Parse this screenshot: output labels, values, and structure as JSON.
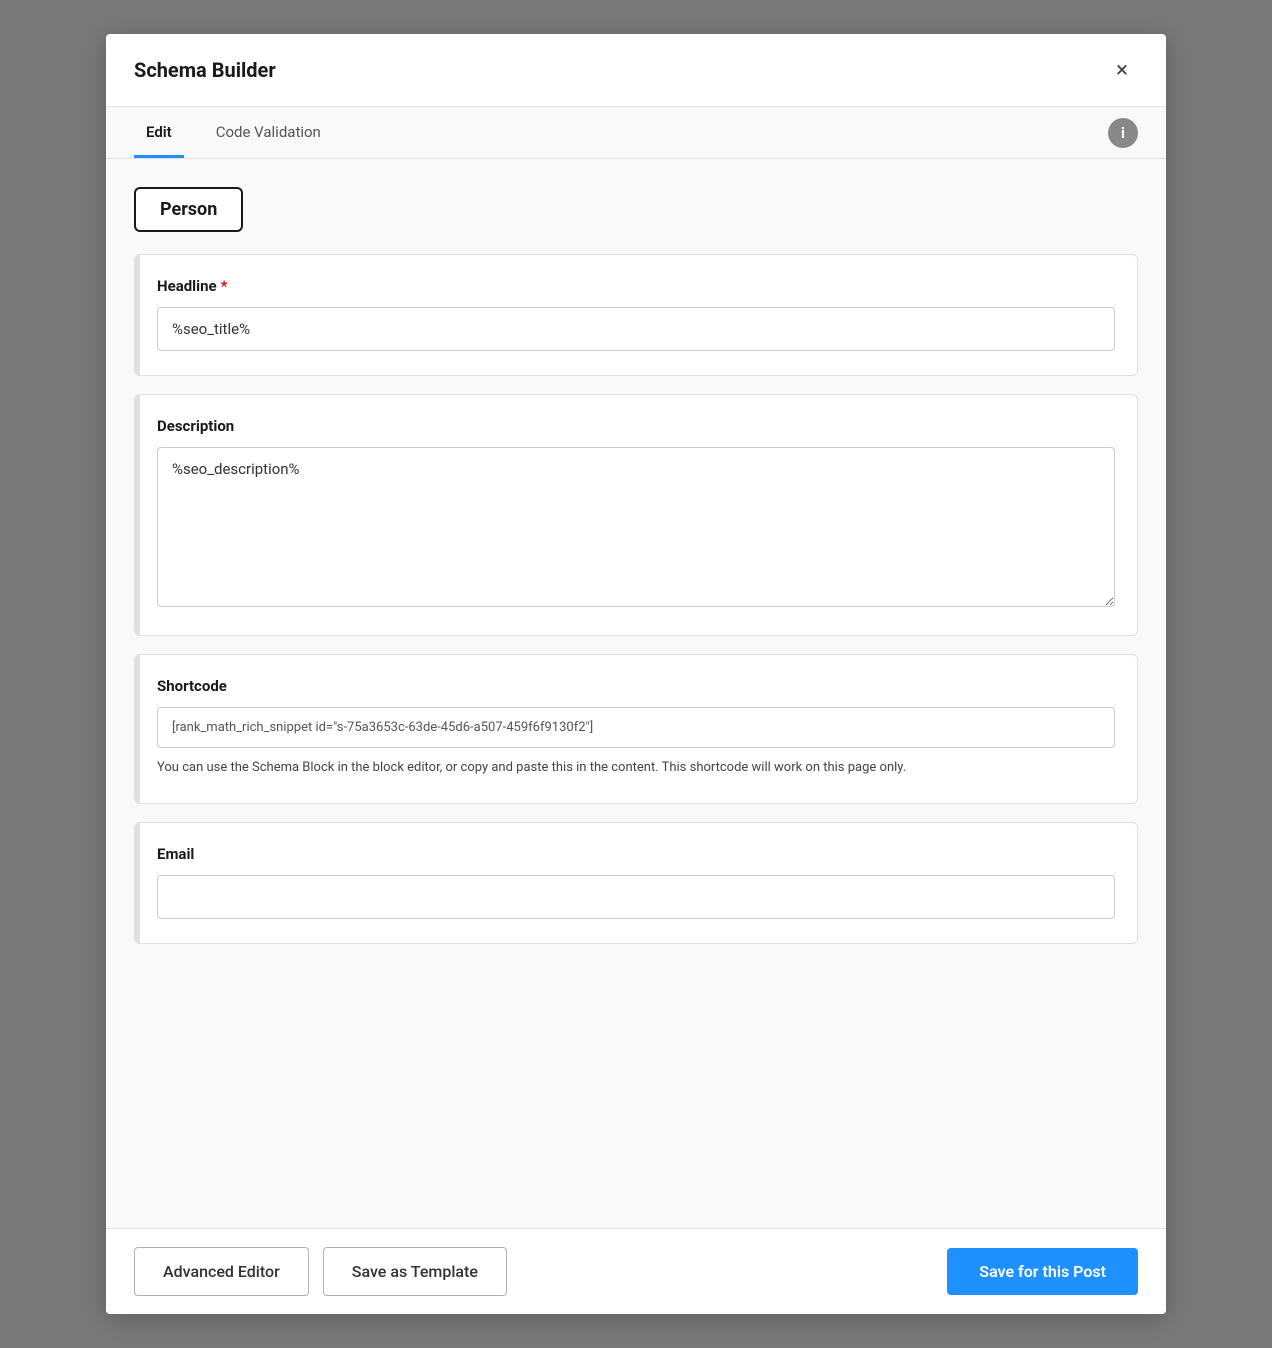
{
  "modal": {
    "title": "Schema Builder",
    "close_label": "×"
  },
  "tabs": {
    "items": [
      {
        "id": "edit",
        "label": "Edit",
        "active": true
      },
      {
        "id": "code-validation",
        "label": "Code Validation",
        "active": false
      }
    ],
    "info_icon_label": "i"
  },
  "person_badge": {
    "label": "Person"
  },
  "fields": {
    "headline": {
      "label": "Headline",
      "required": true,
      "value": "%seo_title%"
    },
    "description": {
      "label": "Description",
      "required": false,
      "value": "%seo_description%"
    },
    "shortcode": {
      "label": "Shortcode",
      "value": "[rank_math_rich_snippet id=\"s-75a3653c-63de-45d6-a507-459f6f9130f2\"]",
      "hint": "You can use the Schema Block in the block editor, or copy and paste this in the content. This shortcode will work on this page only."
    },
    "email": {
      "label": "Email",
      "value": "",
      "placeholder": ""
    }
  },
  "footer": {
    "advanced_editor_label": "Advanced Editor",
    "save_as_template_label": "Save as Template",
    "save_for_post_label": "Save for this Post"
  }
}
